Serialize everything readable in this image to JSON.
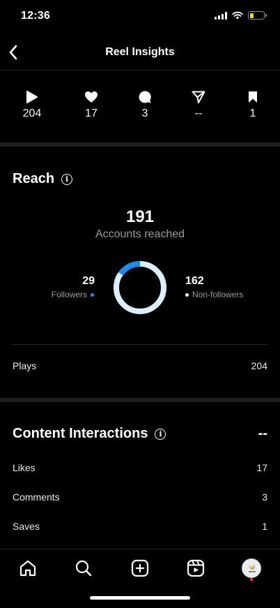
{
  "status_bar": {
    "time": "12:36"
  },
  "header": {
    "title": "Reel Insights"
  },
  "stats": [
    {
      "icon": "play-icon",
      "value": "204"
    },
    {
      "icon": "heart-icon",
      "value": "17"
    },
    {
      "icon": "comment-icon",
      "value": "3"
    },
    {
      "icon": "share-icon",
      "value": "--"
    },
    {
      "icon": "bookmark-icon",
      "value": "1"
    }
  ],
  "reach": {
    "title": "Reach",
    "total": "191",
    "total_label": "Accounts reached",
    "followers_count": "29",
    "followers_label": "Followers",
    "non_followers_count": "162",
    "non_followers_label": "Non-followers",
    "followers_fraction": 0.152,
    "followers_color": "#1d8cf0",
    "non_followers_color": "#dceeff"
  },
  "plays_row": {
    "label": "Plays",
    "value": "204"
  },
  "content_interactions": {
    "title": "Content Interactions",
    "value": "--",
    "rows": [
      {
        "label": "Likes",
        "value": "17"
      },
      {
        "label": "Comments",
        "value": "3"
      },
      {
        "label": "Saves",
        "value": "1"
      }
    ]
  },
  "tabbar": {
    "items": [
      "home-icon",
      "search-icon",
      "create-icon",
      "reels-icon",
      "profile-avatar"
    ]
  }
}
